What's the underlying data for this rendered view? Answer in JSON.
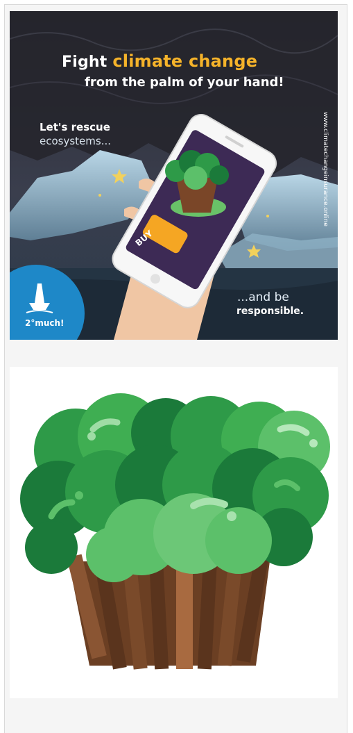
{
  "promo": {
    "headline_lead": "Fight",
    "headline_accent": "climate change",
    "headline_line2": "from the palm of your hand!",
    "rescue_line1": "Let's rescue",
    "rescue_line2": "ecosystems...",
    "side_text": "www.climatechangeinsurance.online",
    "buy_button": "BUY",
    "closing_line1": "...and be",
    "closing_line2": "responsible.",
    "logo_text": "2°much!",
    "colors": {
      "accent": "#f5b32a",
      "logo_bg": "#1e88c8",
      "buy": "#f5a623",
      "phone_screen": "#3d2a55"
    }
  },
  "tree_illustration": {
    "icon": "tree-icon",
    "colors": {
      "dark_green": "#1b7a3a",
      "mid_green": "#2e9a48",
      "light_green": "#5cc06a",
      "trunk": "#6b3f23"
    }
  }
}
